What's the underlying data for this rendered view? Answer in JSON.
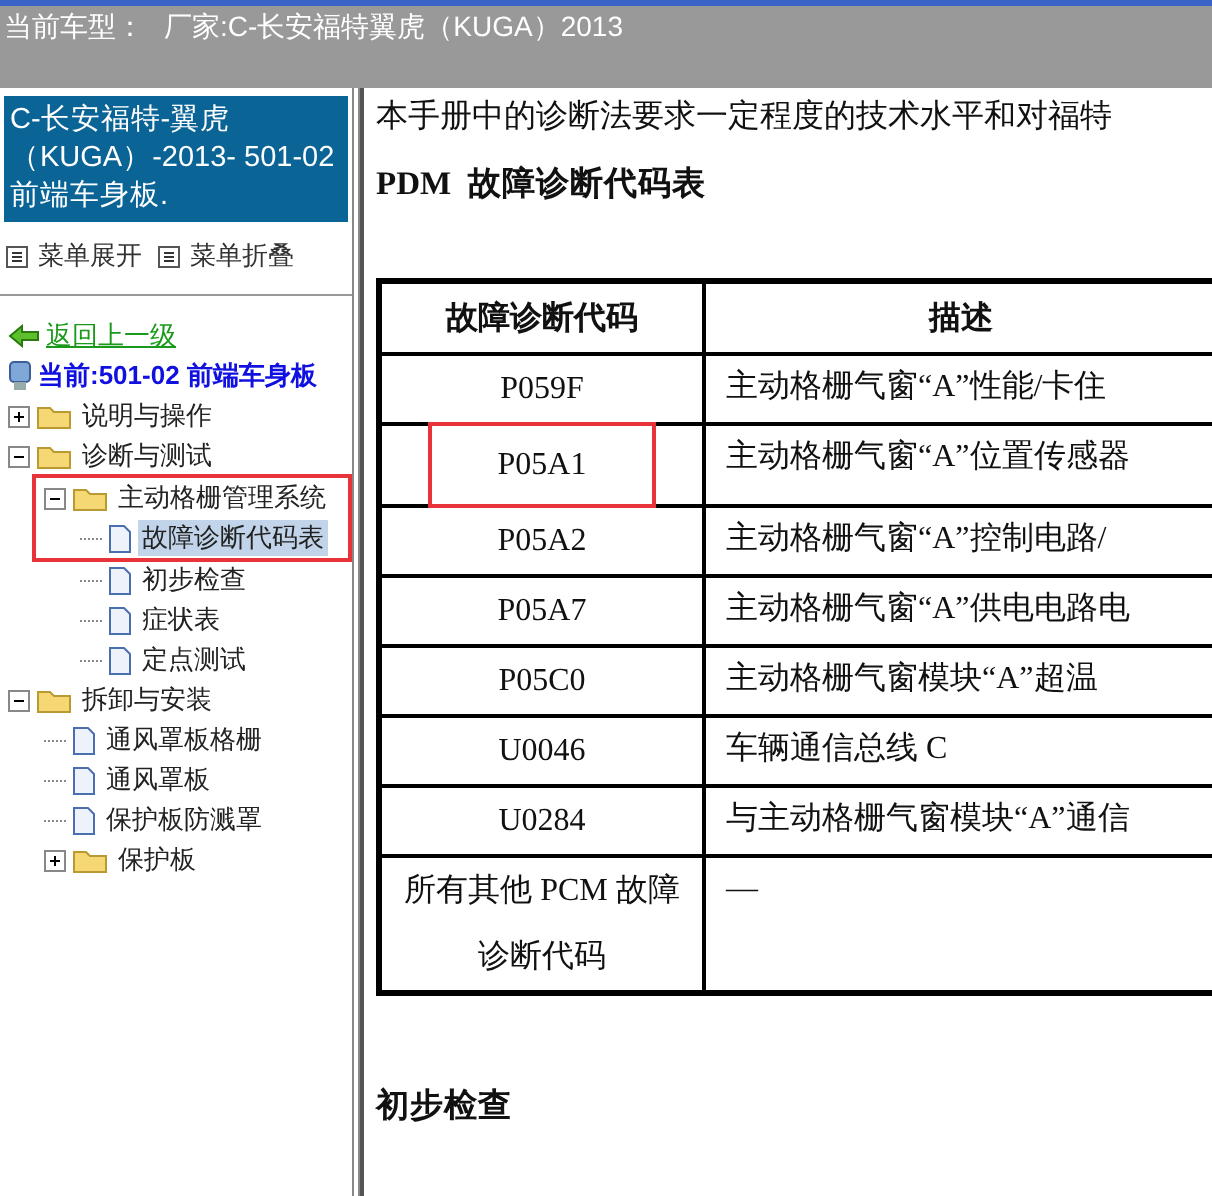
{
  "top_bar": {
    "label": "当前车型：",
    "value": "厂家:C-长安福特翼虎（KUGA）2013"
  },
  "sidebar": {
    "header": "C-长安福特-翼虎（KUGA）-2013- 501-02 前端车身板.",
    "menu_actions": [
      "菜单展开",
      "菜单折叠"
    ],
    "back_link": "返回上一级",
    "current": "当前:501-02 前端车身板",
    "tree": [
      {
        "label": "说明与操作",
        "kind": "folder",
        "expanded": false
      },
      {
        "label": "诊断与测试",
        "kind": "folder",
        "expanded": true,
        "children": [
          {
            "label": "主动格栅管理系统",
            "kind": "folder",
            "expanded": true,
            "highlighted": true,
            "children": [
              {
                "label": "故障诊断代码表",
                "kind": "page",
                "selected": true,
                "highlighted": true
              },
              {
                "label": "初步检查",
                "kind": "page",
                "selected": false
              },
              {
                "label": "症状表",
                "kind": "page",
                "selected": false
              },
              {
                "label": "定点测试",
                "kind": "page",
                "selected": false
              }
            ]
          }
        ]
      },
      {
        "label": "拆卸与安装",
        "kind": "folder",
        "expanded": true,
        "children": [
          {
            "label": "通风罩板格栅",
            "kind": "page",
            "selected": false
          },
          {
            "label": "通风罩板",
            "kind": "page",
            "selected": false
          },
          {
            "label": "保护板防溅罩",
            "kind": "page",
            "selected": false
          },
          {
            "label": "保护板",
            "kind": "folder",
            "expanded": false
          }
        ]
      }
    ]
  },
  "document": {
    "intro": "本手册中的诊断法要求一定程度的技术水平和对福特",
    "heading": "PDM  故障诊断代码表",
    "table": {
      "columns": [
        "故障诊断代码",
        "描述"
      ],
      "rows": [
        {
          "code": "P059F",
          "description": "主动格栅气窗“A”性能/卡住",
          "highlighted": false
        },
        {
          "code": "P05A1",
          "description": "主动格栅气窗“A”位置传感器",
          "highlighted": true
        },
        {
          "code": "P05A2",
          "description": "主动格栅气窗“A”控制电路/",
          "highlighted": false
        },
        {
          "code": "P05A7",
          "description": "主动格栅气窗“A”供电电路电",
          "highlighted": false
        },
        {
          "code": "P05C0",
          "description": "主动格栅气窗模块“A”超温",
          "highlighted": false
        },
        {
          "code": "U0046",
          "description": "车辆通信总线 C",
          "highlighted": false
        },
        {
          "code": "U0284",
          "description": "与主动格栅气窗模块“A”通信",
          "highlighted": false
        },
        {
          "code": "所有其他 PCM 故障诊断代码",
          "description": "—",
          "highlighted": false
        }
      ]
    },
    "section_heading": "初步检查"
  }
}
